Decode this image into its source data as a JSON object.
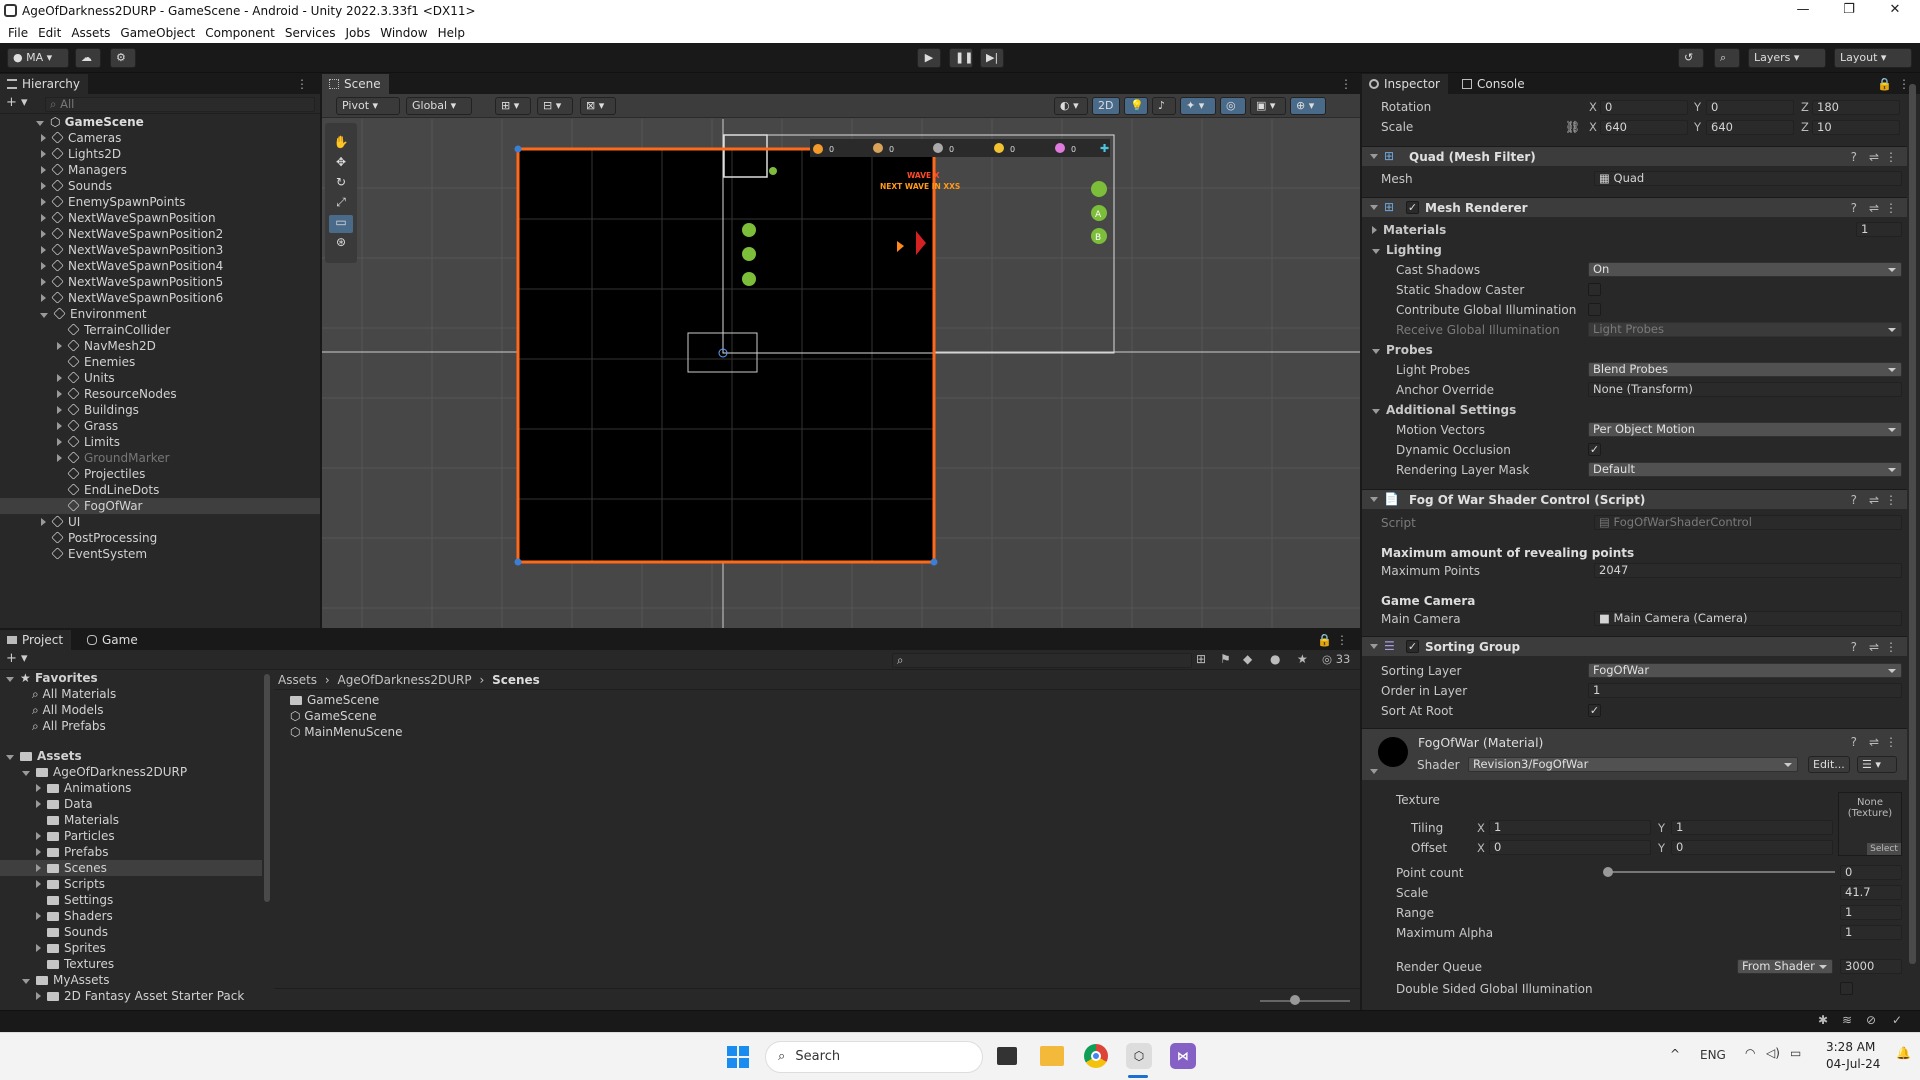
{
  "title": "AgeOfDarkness2DURP - GameScene - Android - Unity 2022.3.33f1 <DX11>",
  "menu": [
    "File",
    "Edit",
    "Assets",
    "GameObject",
    "Component",
    "Services",
    "Jobs",
    "Window",
    "Help"
  ],
  "toolbar": {
    "account": "MA",
    "layers": "Layers",
    "layout": "Layout"
  },
  "hierarchy": {
    "tab": "Hierarchy",
    "search_placeholder": "All",
    "scene": "GameScene",
    "items": [
      {
        "label": "Cameras",
        "depth": 1,
        "arrow": "right"
      },
      {
        "label": "Lights2D",
        "depth": 1,
        "arrow": "right"
      },
      {
        "label": "Managers",
        "depth": 1,
        "arrow": "right"
      },
      {
        "label": "Sounds",
        "depth": 1,
        "arrow": "right"
      },
      {
        "label": "EnemySpawnPoints",
        "depth": 1,
        "arrow": "right"
      },
      {
        "label": "NextWaveSpawnPosition",
        "depth": 1,
        "arrow": "right"
      },
      {
        "label": "NextWaveSpawnPosition2",
        "depth": 1,
        "arrow": "right"
      },
      {
        "label": "NextWaveSpawnPosition3",
        "depth": 1,
        "arrow": "right"
      },
      {
        "label": "NextWaveSpawnPosition4",
        "depth": 1,
        "arrow": "right"
      },
      {
        "label": "NextWaveSpawnPosition5",
        "depth": 1,
        "arrow": "right"
      },
      {
        "label": "NextWaveSpawnPosition6",
        "depth": 1,
        "arrow": "right"
      },
      {
        "label": "Environment",
        "depth": 1,
        "arrow": "down"
      },
      {
        "label": "TerrainCollider",
        "depth": 2,
        "arrow": "none"
      },
      {
        "label": "NavMesh2D",
        "depth": 2,
        "arrow": "right"
      },
      {
        "label": "Enemies",
        "depth": 2,
        "arrow": "none"
      },
      {
        "label": "Units",
        "depth": 2,
        "arrow": "right"
      },
      {
        "label": "ResourceNodes",
        "depth": 2,
        "arrow": "right"
      },
      {
        "label": "Buildings",
        "depth": 2,
        "arrow": "right"
      },
      {
        "label": "Grass",
        "depth": 2,
        "arrow": "right"
      },
      {
        "label": "Limits",
        "depth": 2,
        "arrow": "right"
      },
      {
        "label": "GroundMarker",
        "depth": 2,
        "arrow": "right",
        "dim": true
      },
      {
        "label": "Projectiles",
        "depth": 2,
        "arrow": "none"
      },
      {
        "label": "EndLineDots",
        "depth": 2,
        "arrow": "none"
      },
      {
        "label": "FogOfWar",
        "depth": 2,
        "arrow": "none",
        "selected": true
      },
      {
        "label": "UI",
        "depth": 1,
        "arrow": "right"
      },
      {
        "label": "PostProcessing",
        "depth": 1,
        "arrow": "none"
      },
      {
        "label": "EventSystem",
        "depth": 1,
        "arrow": "none"
      }
    ]
  },
  "scene": {
    "tab": "Scene",
    "pivot": "Pivot",
    "global": "Global",
    "mode2d": "2D",
    "wave_label": "WAVE X",
    "next_wave": "NEXT WAVE IN XXS",
    "counters": [
      "0",
      "0",
      "0",
      "0",
      "0"
    ],
    "side_badges": [
      "A",
      "B"
    ]
  },
  "project": {
    "tabs": [
      "Project",
      "Game"
    ],
    "favorites_title": "Favorites",
    "favorites": [
      "All Materials",
      "All Models",
      "All Prefabs"
    ],
    "assets_title": "Assets",
    "tree": [
      {
        "label": "AgeOfDarkness2DURP",
        "depth": 1,
        "arrow": "down"
      },
      {
        "label": "Animations",
        "depth": 2,
        "arrow": "right"
      },
      {
        "label": "Data",
        "depth": 2,
        "arrow": "right"
      },
      {
        "label": "Materials",
        "depth": 2,
        "arrow": "none"
      },
      {
        "label": "Particles",
        "depth": 2,
        "arrow": "right"
      },
      {
        "label": "Prefabs",
        "depth": 2,
        "arrow": "right"
      },
      {
        "label": "Scenes",
        "depth": 2,
        "arrow": "right",
        "selected": true
      },
      {
        "label": "Scripts",
        "depth": 2,
        "arrow": "right"
      },
      {
        "label": "Settings",
        "depth": 2,
        "arrow": "none"
      },
      {
        "label": "Shaders",
        "depth": 2,
        "arrow": "right"
      },
      {
        "label": "Sounds",
        "depth": 2,
        "arrow": "none"
      },
      {
        "label": "Sprites",
        "depth": 2,
        "arrow": "right"
      },
      {
        "label": "Textures",
        "depth": 2,
        "arrow": "none"
      },
      {
        "label": "MyAssets",
        "depth": 1,
        "arrow": "down"
      },
      {
        "label": "2D Fantasy Asset Starter Pack",
        "depth": 2,
        "arrow": "right"
      }
    ],
    "breadcrumb": [
      "Assets",
      "AgeOfDarkness2DURP",
      "Scenes"
    ],
    "files": [
      {
        "label": "GameScene",
        "kind": "folder"
      },
      {
        "label": "GameScene",
        "kind": "scene"
      },
      {
        "label": "MainMenuScene",
        "kind": "scene"
      }
    ],
    "hidden_count": "33"
  },
  "inspector": {
    "tabs": [
      "Inspector",
      "Console"
    ],
    "rotation": {
      "label": "Rotation",
      "x": "0",
      "y": "0",
      "z": "180"
    },
    "scale": {
      "label": "Scale",
      "x": "640",
      "y": "640",
      "z": "10"
    },
    "mesh_filter": {
      "title": "Quad (Mesh Filter)",
      "mesh_label": "Mesh",
      "mesh_value": "Quad"
    },
    "mesh_renderer": {
      "title": "Mesh Renderer",
      "materials_label": "Materials",
      "materials_count": "1",
      "lighting": "Lighting",
      "cast_shadows_label": "Cast Shadows",
      "cast_shadows": "On",
      "static_shadow_label": "Static Shadow Caster",
      "contribute_gi_label": "Contribute Global Illumination",
      "receive_gi_label": "Receive Global Illumination",
      "receive_gi": "Light Probes",
      "probes": "Probes",
      "light_probes_label": "Light Probes",
      "light_probes": "Blend Probes",
      "anchor_label": "Anchor Override",
      "anchor": "None (Transform)",
      "additional": "Additional Settings",
      "motion_label": "Motion Vectors",
      "motion": "Per Object Motion",
      "dynocc_label": "Dynamic Occlusion",
      "layer_mask_label": "Rendering Layer Mask",
      "layer_mask": "Default"
    },
    "fog_script": {
      "title": "Fog Of War Shader Control (Script)",
      "script_label": "Script",
      "script": "FogOfWarShaderControl",
      "max_header": "Maximum amount of revealing points",
      "max_label": "Maximum Points",
      "max_value": "2047",
      "cam_header": "Game Camera",
      "cam_label": "Main Camera",
      "cam_value": "Main Camera (Camera)"
    },
    "sorting_group": {
      "title": "Sorting Group",
      "layer_label": "Sorting Layer",
      "layer": "FogOfWar",
      "order_label": "Order in Layer",
      "order": "1",
      "root_label": "Sort At Root"
    },
    "material": {
      "title": "FogOfWar (Material)",
      "shader_label": "Shader",
      "shader": "Revision3/FogOfWar",
      "edit": "Edit...",
      "texture_label": "Texture",
      "texture_value": "None (Texture)",
      "select": "Select",
      "tiling_label": "Tiling",
      "tiling_x": "1",
      "tiling_y": "1",
      "offset_label": "Offset",
      "offset_x": "0",
      "offset_y": "0",
      "point_count_label": "Point count",
      "point_count": "0",
      "point_count_fraction": 0,
      "scale_label": "Scale",
      "scale": "41.7",
      "range_label": "Range",
      "range": "1",
      "alpha_label": "Maximum Alpha",
      "alpha": "1",
      "queue_label": "Render Queue",
      "queue_mode": "From Shader",
      "queue": "3000",
      "dsgi_label": "Double Sided Global Illumination"
    }
  },
  "taskbar": {
    "search": "Search",
    "lang": "ENG",
    "time": "3:28 AM",
    "date": "04-Jul-24"
  }
}
